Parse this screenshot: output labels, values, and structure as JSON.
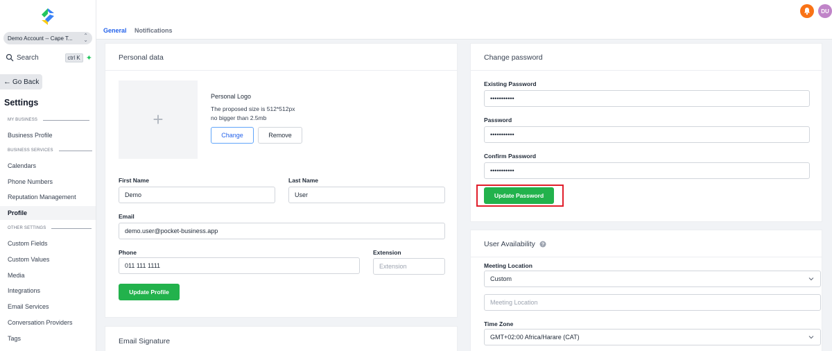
{
  "sidebar": {
    "account": "Demo Account -- Cape T...",
    "search_label": "Search",
    "search_shortcut": "ctrl K",
    "go_back": "Go Back",
    "title": "Settings",
    "section_my_business": "MY BUSINESS",
    "section_business_services": "BUSINESS SERVICES",
    "section_other_settings": "OTHER SETTINGS",
    "items": [
      {
        "label": "Business Profile"
      },
      {
        "label": "Calendars"
      },
      {
        "label": "Phone Numbers"
      },
      {
        "label": "Reputation Management"
      },
      {
        "label": "Profile"
      },
      {
        "label": "Custom Fields"
      },
      {
        "label": "Custom Values"
      },
      {
        "label": "Media"
      },
      {
        "label": "Integrations"
      },
      {
        "label": "Email Services"
      },
      {
        "label": "Conversation Providers"
      },
      {
        "label": "Tags"
      }
    ],
    "active_item": "Profile"
  },
  "header": {
    "tabs": [
      {
        "label": "General"
      },
      {
        "label": "Notifications"
      }
    ],
    "active_tab": "General",
    "avatar_initials": "DU"
  },
  "personal": {
    "title": "Personal data",
    "logo_title": "Personal Logo",
    "logo_hint_1": "The proposed size is 512*512px",
    "logo_hint_2": "no bigger than 2.5mb",
    "change": "Change",
    "remove": "Remove",
    "first_name_label": "First Name",
    "first_name": "Demo",
    "last_name_label": "Last Name",
    "last_name": "User",
    "email_label": "Email",
    "email": "demo.user@pocket-business.app",
    "phone_label": "Phone",
    "phone": "011 111 1111",
    "extension_label": "Extension",
    "extension_placeholder": "Extension",
    "update_profile": "Update Profile"
  },
  "signature": {
    "title": "Email Signature"
  },
  "password": {
    "title": "Change password",
    "existing_label": "Existing Password",
    "existing_value": "•••••••••••",
    "password_label": "Password",
    "password_value": "•••••••••••",
    "confirm_label": "Confirm Password",
    "confirm_value": "•••••••••••",
    "update_password": "Update Password"
  },
  "availability": {
    "title": "User Availability",
    "meeting_location_label": "Meeting Location",
    "meeting_location_value": "Custom",
    "meeting_location_placeholder": "Meeting Location",
    "timezone_label": "Time Zone",
    "timezone_value": "GMT+02:00 Africa/Harare (CAT)"
  },
  "colors": {
    "accent_blue": "#2563eb",
    "primary_green": "#22b24c",
    "highlight_red": "#e11d2a",
    "bell_orange": "#f97316"
  }
}
